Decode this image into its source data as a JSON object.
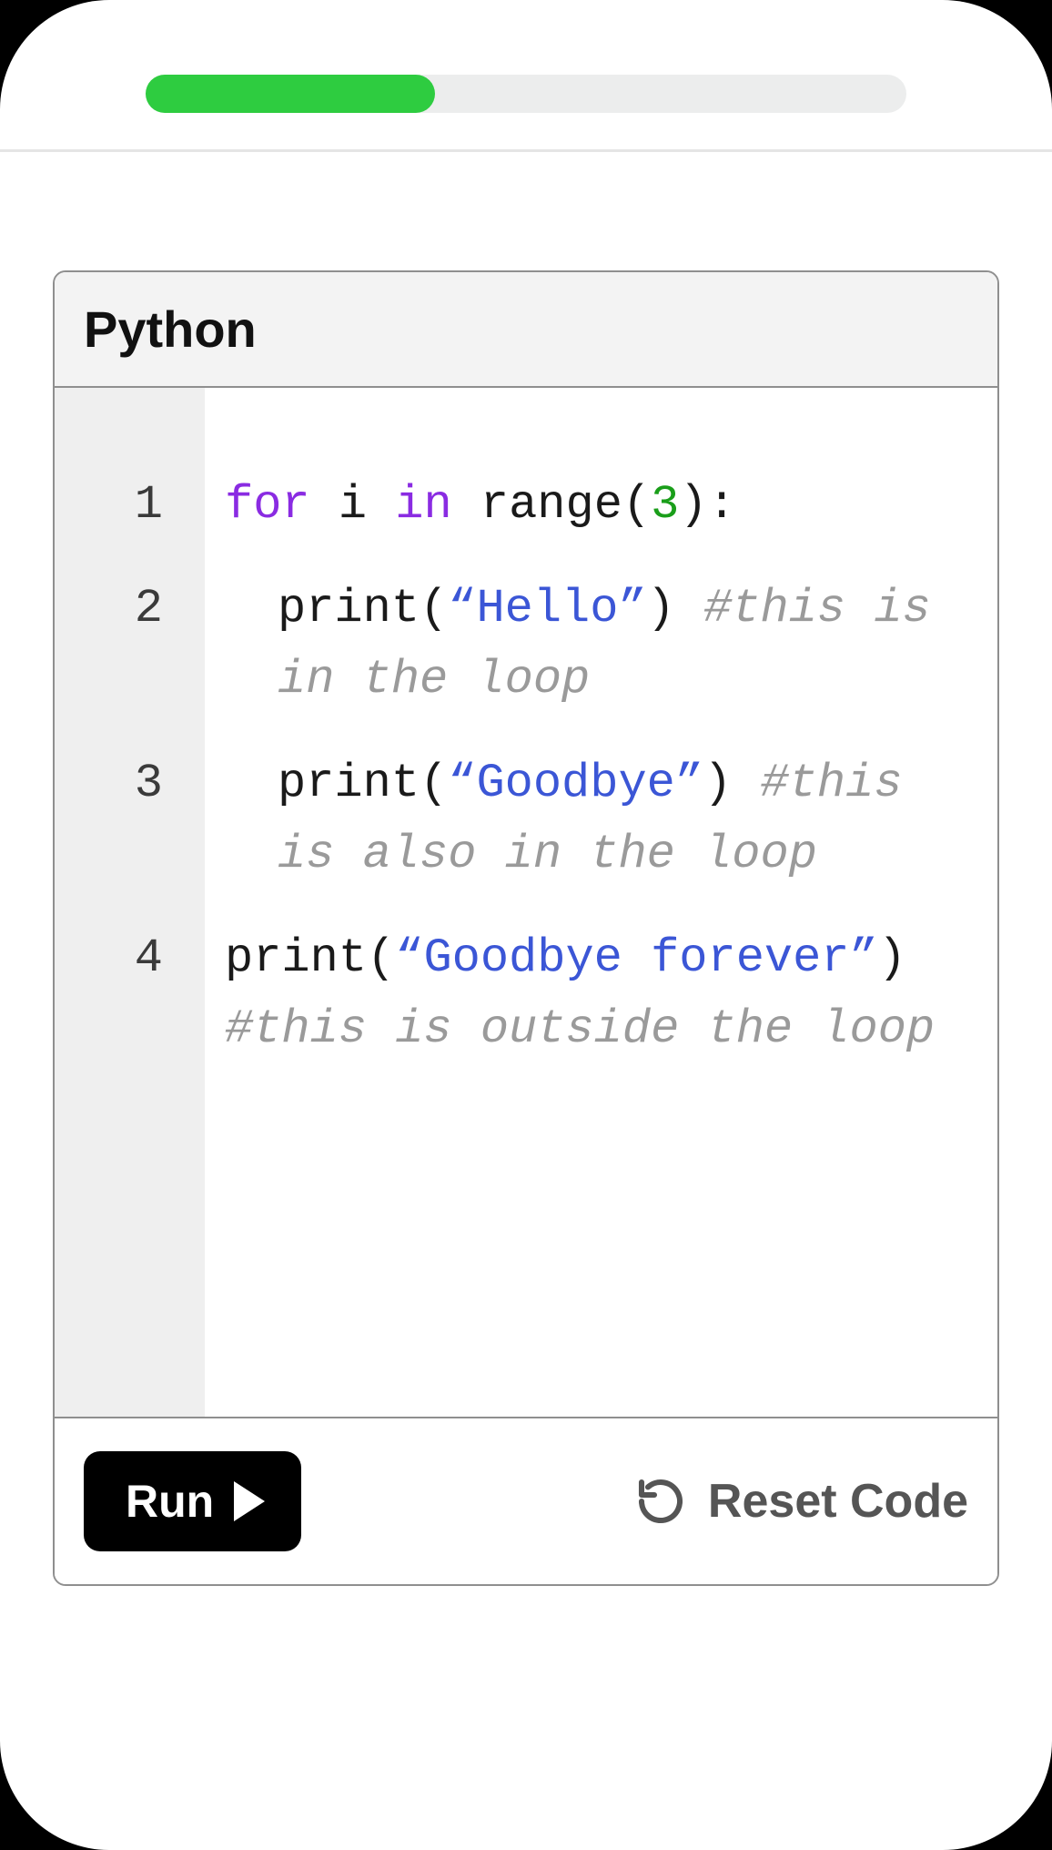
{
  "progress": {
    "percent": 38
  },
  "panel": {
    "title": "Python"
  },
  "code": {
    "lines": [
      {
        "num": "1",
        "indent": 0,
        "tokens": [
          {
            "t": "kw",
            "v": "for"
          },
          {
            "t": "txt",
            "v": " i "
          },
          {
            "t": "kw",
            "v": "in"
          },
          {
            "t": "txt",
            "v": " range("
          },
          {
            "t": "num",
            "v": "3"
          },
          {
            "t": "txt",
            "v": "):"
          }
        ]
      },
      {
        "num": "2",
        "indent": 1,
        "tokens": [
          {
            "t": "txt",
            "v": "print("
          },
          {
            "t": "str",
            "v": "“Hello”"
          },
          {
            "t": "txt",
            "v": ") "
          },
          {
            "t": "cm",
            "v": "#this is in the loop"
          }
        ]
      },
      {
        "num": "3",
        "indent": 1,
        "tokens": [
          {
            "t": "txt",
            "v": "print("
          },
          {
            "t": "str",
            "v": "“Goodbye”"
          },
          {
            "t": "txt",
            "v": ") "
          },
          {
            "t": "cm",
            "v": "#this is also in the loop"
          }
        ]
      },
      {
        "num": "4",
        "indent": 0,
        "tokens": [
          {
            "t": "txt",
            "v": "print("
          },
          {
            "t": "str",
            "v": "“Goodbye forever”"
          },
          {
            "t": "txt",
            "v": ") "
          },
          {
            "t": "cm",
            "v": "#this is outside the loop"
          }
        ]
      }
    ]
  },
  "footer": {
    "run_label": "Run",
    "reset_label": "Reset Code"
  }
}
